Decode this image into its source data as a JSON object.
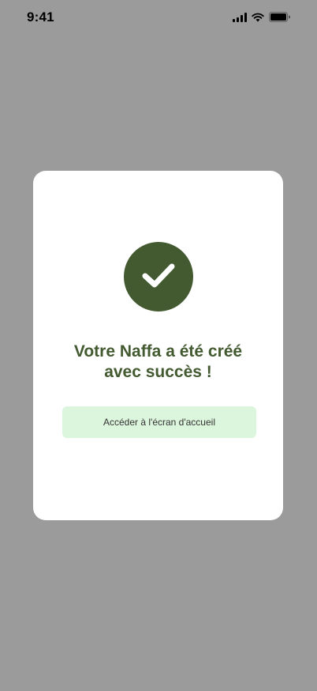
{
  "status_bar": {
    "time": "9:41",
    "icons": [
      "signal-icon",
      "wifi-icon",
      "battery-icon"
    ]
  },
  "dialog": {
    "icon": "check-icon",
    "title_line1": "Votre Naffa a été créé",
    "title_line2": "avec succès !",
    "button_label": "Accéder à l'écran d'accueil"
  },
  "colors": {
    "overlay": "#9b9b9b",
    "dialog_bg": "#ffffff",
    "accent": "#435a30",
    "button_bg": "#dcf5dd",
    "button_text": "#333333"
  }
}
